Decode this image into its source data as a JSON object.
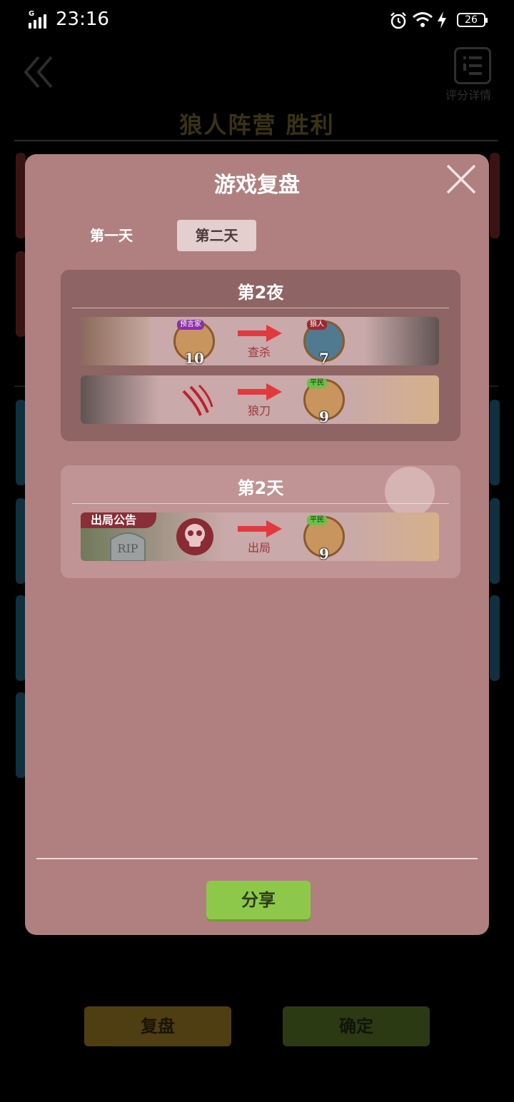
{
  "status_bar": {
    "time": "23:16",
    "battery": "26",
    "network": "G",
    "icons": [
      "alarm-icon",
      "wifi-icon",
      "charging-icon"
    ]
  },
  "background": {
    "menu_label": "评分详情",
    "result_title": "狼人阵营  胜利",
    "buttons": {
      "review": "复盘",
      "confirm": "确定"
    }
  },
  "modal": {
    "title": "游戏复盘",
    "tabs": [
      {
        "label": "第一天",
        "selected": false
      },
      {
        "label": "第二天",
        "selected": true
      }
    ],
    "sections": [
      {
        "title": "第2夜",
        "events": [
          {
            "actor_role": "预言家",
            "actor_number": "10",
            "action": "查杀",
            "target_role": "狼人",
            "target_number": "7"
          },
          {
            "actor_role": "",
            "actor_number": "",
            "action": "狼刀",
            "target_role": "平民",
            "target_number": "9"
          }
        ]
      },
      {
        "title": "第2天",
        "events": [
          {
            "tag": "出局公告",
            "tombstone_text": "RIP",
            "action": "出局",
            "target_role": "平民",
            "target_number": "9"
          }
        ]
      }
    ],
    "share_label": "分享"
  },
  "colors": {
    "modal_bg": "#b08080",
    "night_section": "#8e6464",
    "day_section": "#c09494",
    "share_button": "#8ec84a",
    "arrow_red": "#e2393f",
    "announcement_tag": "#8a2e38"
  }
}
